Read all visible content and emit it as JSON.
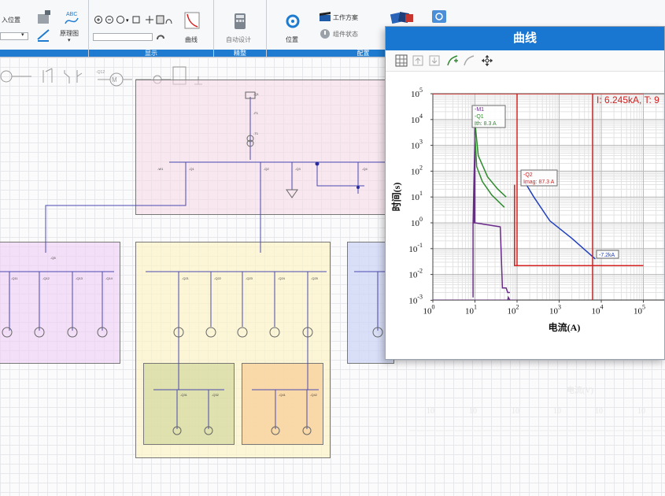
{
  "ribbon": {
    "groups": [
      {
        "label": ""
      },
      {
        "label": "显示"
      },
      {
        "label": "精整"
      },
      {
        "label": "配置"
      }
    ],
    "labels": {
      "insert_position": "入位置",
      "principle_diagram": "原理图",
      "curve": "曲线",
      "auto_design": "自动设计",
      "position": "位置",
      "work_plan": "工作方案",
      "component_status": "组件状态"
    }
  },
  "curve_window": {
    "title": "曲线",
    "cursor_readout": "I: 6.245kA, T: 9",
    "tags": {
      "tag1_line1": "-M1",
      "tag1_line2": "-Q1",
      "tag1_line3": "Ith: 8.3 A",
      "tag2_line1": "-Q2",
      "tag2_line2": "Imag: 87.3 A",
      "tag3": "-7.2kA"
    },
    "colors": {
      "title_bar": "#1977d2",
      "accent": "#1e7bd0"
    }
  },
  "chart_data": {
    "type": "line",
    "xlabel": "电流(A)",
    "ylabel": "时间(s)",
    "x_scale": "log",
    "y_scale": "log",
    "xlim": [
      1,
      1000000
    ],
    "ylim": [
      0.001,
      100000
    ],
    "x_tick_labels": [
      {
        "base": "10",
        "exp": "0"
      },
      {
        "base": "10",
        "exp": "1"
      },
      {
        "base": "10",
        "exp": "2"
      },
      {
        "base": "10",
        "exp": "3"
      },
      {
        "base": "10",
        "exp": "4"
      },
      {
        "base": "10",
        "exp": "5"
      }
    ],
    "y_tick_labels": [
      {
        "base": "10",
        "exp": "-3"
      },
      {
        "base": "10",
        "exp": "-2"
      },
      {
        "base": "10",
        "exp": "-1"
      },
      {
        "base": "10",
        "exp": "0"
      },
      {
        "base": "10",
        "exp": "1"
      },
      {
        "base": "10",
        "exp": "2"
      },
      {
        "base": "10",
        "exp": "3"
      },
      {
        "base": "10",
        "exp": "4"
      },
      {
        "base": "10",
        "exp": "5"
      }
    ],
    "grid": true,
    "series": [
      {
        "color": "#6a2a8c",
        "points": [
          [
            1,
            0.001
          ],
          [
            60,
            0.001
          ],
          [
            62,
            0.0013
          ],
          [
            68,
            0.001
          ],
          [
            100,
            0.001
          ]
        ]
      },
      {
        "color": "#6a2a8c",
        "points": [
          [
            9,
            0.0013
          ],
          [
            9,
            1
          ],
          [
            10,
            2000
          ],
          [
            10,
            8000
          ],
          [
            9.5,
            1
          ],
          [
            9.3,
            1
          ]
        ]
      },
      {
        "color": "#6a2a8c",
        "points": [
          [
            10,
            8000
          ],
          [
            10,
            1
          ],
          [
            40,
            0.7
          ],
          [
            45,
            0.003
          ],
          [
            55,
            0.003
          ],
          [
            60,
            0.002
          ],
          [
            68,
            0.002
          ]
        ]
      },
      {
        "color": "#2e8b2e",
        "points": [
          [
            10,
            2500
          ],
          [
            11,
            150
          ],
          [
            15,
            40
          ],
          [
            25,
            12
          ],
          [
            50,
            4
          ]
        ]
      },
      {
        "color": "#2e8b2e",
        "points": [
          [
            10,
            8000
          ],
          [
            12,
            400
          ],
          [
            20,
            60
          ],
          [
            35,
            20
          ],
          [
            55,
            10
          ]
        ]
      },
      {
        "color": "#1f3fbf",
        "points": [
          [
            150,
            40
          ],
          [
            250,
            10
          ],
          [
            600,
            1.2
          ],
          [
            2000,
            0.25
          ],
          [
            7200,
            0.04
          ]
        ]
      },
      {
        "color": "#d62020",
        "points": [
          [
            87.3,
            30
          ],
          [
            87.3,
            0.022
          ],
          [
            100000,
            0.022
          ]
        ]
      },
      {
        "color": "#d62020",
        "points": [
          [
            100,
            100000
          ],
          [
            100,
            0.022
          ]
        ]
      },
      {
        "color": "#d62020",
        "points": [
          [
            6245,
            100000
          ],
          [
            6245,
            0.001
          ]
        ]
      },
      {
        "color": "#d62020",
        "points": [
          [
            1,
            100000
          ],
          [
            100000,
            100000
          ]
        ]
      }
    ]
  }
}
